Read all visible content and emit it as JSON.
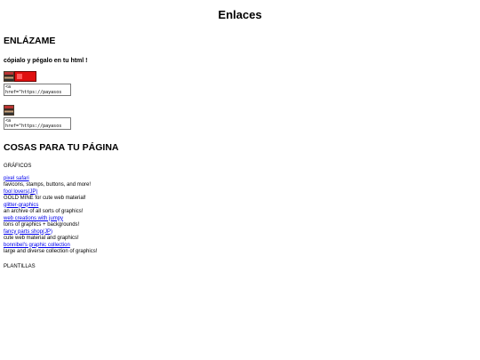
{
  "page": {
    "title": "Enlaces"
  },
  "enlazame": {
    "heading": "ENLÁZAME",
    "subheading": "cópialo y pégalo en tu html !",
    "code_line1": "<a",
    "code_line2": "href=\"https://payasos"
  },
  "cosas": {
    "heading": "COSAS PARA TU PÁGINA",
    "graficos_label": "GRÁFICOS",
    "links": [
      {
        "label": "pixel safari",
        "desc": "favicons, stamps, buttons, and more!"
      },
      {
        "label": "fool lovers(JP)",
        "desc": "GOLD MINE for cute web material!"
      },
      {
        "label": "glitter-graphics",
        "desc": "an archive of all sorts of graphics!"
      },
      {
        "label": "web creations with jumpy",
        "desc": "tons of graphics + backgrounds!"
      },
      {
        "label": "fancy parts shop(JP)",
        "desc": "cute web material and graphics!"
      },
      {
        "label": "bonnibel's graphic collection",
        "desc": "large and diverse collection of graphics!"
      }
    ],
    "plantillas_label": "PLANTILLAS"
  }
}
